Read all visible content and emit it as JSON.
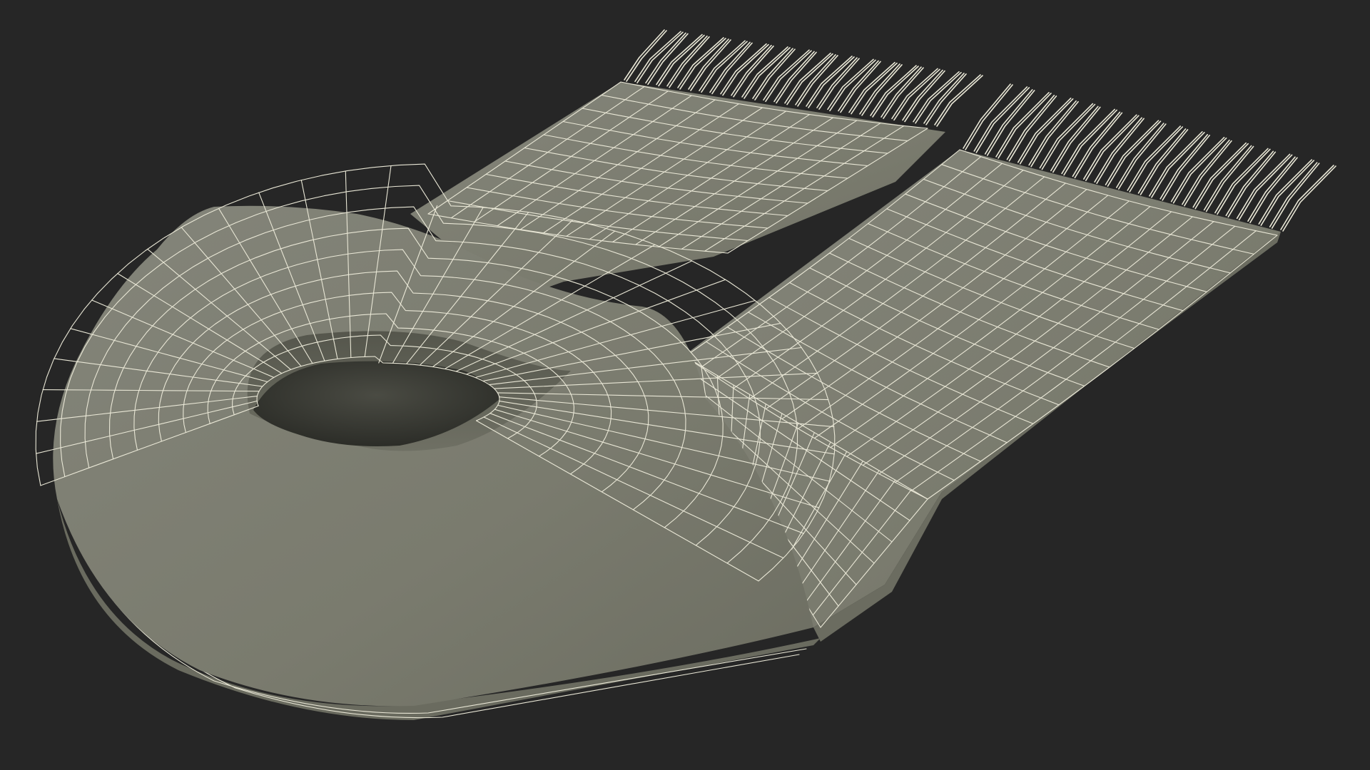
{
  "scene": {
    "subject": "scarf-wireframe-model",
    "render_mode": "wireframe",
    "colors": {
      "background": "#262626",
      "surface": "#7d7e70",
      "surface_shadow": "#5f6055",
      "surface_dark": "#3e3f38",
      "wire": "#e9e7d6"
    }
  }
}
